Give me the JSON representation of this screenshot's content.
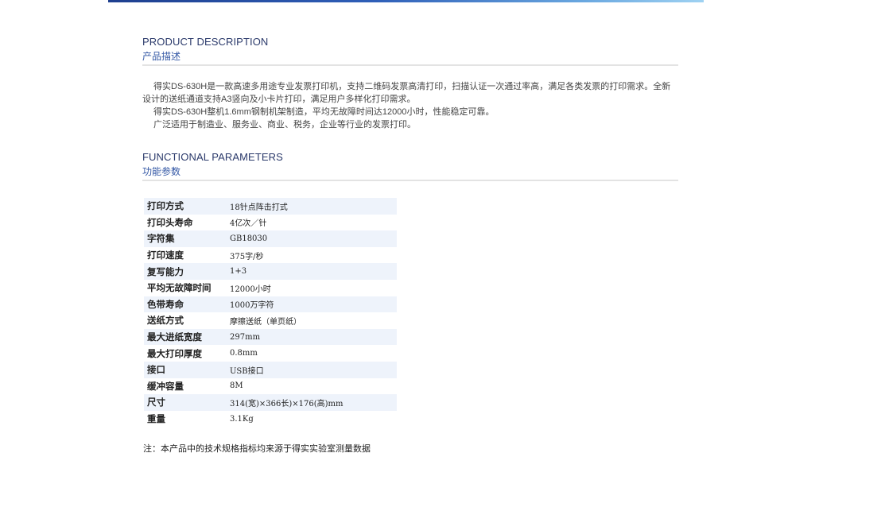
{
  "product_description": {
    "title_en": "PRODUCT DESCRIPTION",
    "title_cn": "产品描述",
    "paragraph_1": "得实DS-630H是一款高速多用途专业发票打印机，支持二维码发票高清打印，扫描认证一次通过率高，满足各类发票的打印需求。全新设计的送纸通道支持A3竖向及小卡片打印，满足用户多样化打印需求。",
    "paragraph_2": "得实DS-630H整机1.6mm钢制机架制造，平均无故障时间达12000小时，性能稳定可靠。",
    "paragraph_3": "广泛适用于制造业、服务业、商业、税务，企业等行业的发票打印。"
  },
  "functional_parameters": {
    "title_en": "FUNCTIONAL PARAMETERS",
    "title_cn": "功能参数",
    "rows": [
      {
        "key": "打印方式",
        "value": "18针点阵击打式"
      },
      {
        "key": "打印头寿命",
        "value": "4亿次／针"
      },
      {
        "key": "字符集",
        "value": "GB18030"
      },
      {
        "key": "打印速度",
        "value": "375字/秒"
      },
      {
        "key": "复写能力",
        "value": "1+3"
      },
      {
        "key": "平均无故障时间",
        "value": "12000小时"
      },
      {
        "key": "色带寿命",
        "value": "1000万字符"
      },
      {
        "key": "送纸方式",
        "value": "摩擦送纸（单页纸）"
      },
      {
        "key": "最大进纸宽度",
        "value": "297mm"
      },
      {
        "key": "最大打印厚度",
        "value": "0.8mm"
      },
      {
        "key": "接口",
        "value": "USB接口"
      },
      {
        "key": "缓冲容量",
        "value": "8M"
      },
      {
        "key": "尺寸",
        "value": "314(宽)×366长)×176(高)mm"
      },
      {
        "key": "重量",
        "value": "3.1Kg"
      }
    ]
  },
  "note": "注：本产品中的技术规格指标均来源于得实实验室测量数据",
  "colors": {
    "banner_start": "#1e3f8f",
    "banner_end": "#9fd2f2",
    "title_cn": "#3559a6",
    "row_stripe": "#eef3fb"
  }
}
